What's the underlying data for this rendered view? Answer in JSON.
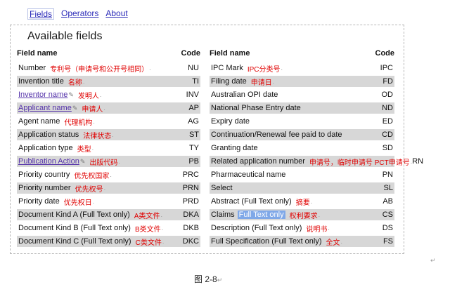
{
  "nav": {
    "fields": "Fields",
    "operators": "Operators",
    "about": "About"
  },
  "panel_title": "Available fields",
  "headers": {
    "field_name": "Field name",
    "code": "Code"
  },
  "left_rows": [
    {
      "name": "Number",
      "cn": "专利号（申请号和公开号相同）",
      "code": "NU"
    },
    {
      "name": "Invention title",
      "cn": "名称",
      "code": "TI"
    },
    {
      "name": "Inventor name",
      "cn": "发明人",
      "code": "INV",
      "link": true
    },
    {
      "name": "Applicant name",
      "cn": "申请人",
      "code": "AP",
      "link": true
    },
    {
      "name": "Agent name",
      "cn": "代理机构",
      "code": "AG"
    },
    {
      "name": "Application status",
      "cn": "法律状态",
      "code": "ST"
    },
    {
      "name": "Application type",
      "cn": "类型",
      "code": "TY"
    },
    {
      "name": "Publication Action",
      "cn": "出版代码",
      "code": "PB",
      "link": true
    },
    {
      "name": "Priority country",
      "cn": "优先权国家",
      "code": "PRC"
    },
    {
      "name": "Priority number",
      "cn": "优先权号",
      "code": "PRN"
    },
    {
      "name": "Priority date",
      "cn": "优先权日",
      "code": "PRD"
    },
    {
      "name": "Document Kind A (Full Text only)",
      "cn": "A类文件",
      "code": "DKA"
    },
    {
      "name": "Document Kind B (Full Text only)",
      "cn": "B类文件",
      "code": "DKB"
    },
    {
      "name": "Document Kind C (Full Text only)",
      "cn": "C类文件",
      "code": "DKC"
    }
  ],
  "right_rows": [
    {
      "name": "IPC Mark",
      "cn": "IPC分类号",
      "code": "IPC"
    },
    {
      "name": "Filing date",
      "cn": "申请日",
      "code": "FD"
    },
    {
      "name": "Australian OPI date",
      "cn": "",
      "code": "OD"
    },
    {
      "name": "National Phase Entry date",
      "cn": "",
      "code": "ND"
    },
    {
      "name": "Expiry date",
      "cn": "",
      "code": "ED"
    },
    {
      "name": "Continuation/Renewal fee paid to date",
      "cn": "",
      "code": "CD"
    },
    {
      "name": "Granting date",
      "cn": "",
      "code": "SD"
    },
    {
      "name": "Related application number",
      "cn": "申请号，临时申请号 PCT申请号",
      "code": "RN"
    },
    {
      "name": "Pharmaceutical name",
      "cn": "",
      "code": "PN"
    },
    {
      "name": "Select",
      "cn": "",
      "code": "SL"
    },
    {
      "name": "Abstract (Full Text only)",
      "cn": "摘要",
      "code": "AB"
    },
    {
      "name": "Claims",
      "hl": "Full Text only",
      "cn": "权利要求",
      "code": "CS"
    },
    {
      "name": "Description (Full Text only)",
      "cn": "说明书",
      "code": "DS"
    },
    {
      "name": "Full Specification (Full Text only)",
      "cn": "全文",
      "code": "FS"
    }
  ],
  "caption": "图 2-8"
}
